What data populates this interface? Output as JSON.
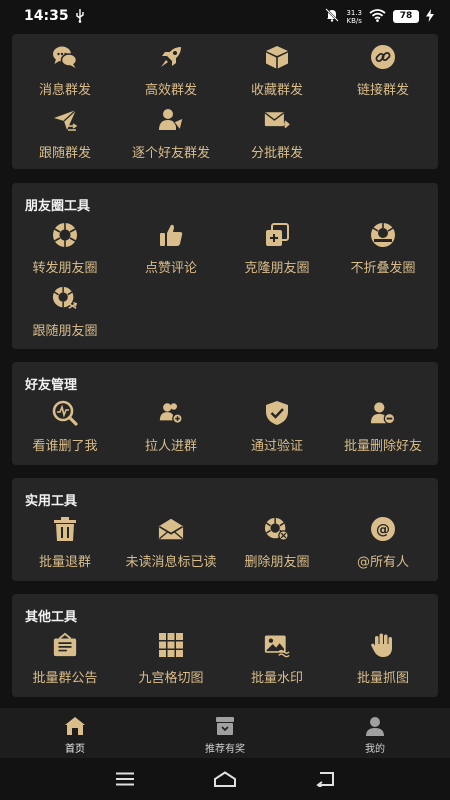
{
  "status_bar": {
    "time": "14:35",
    "usb_icon": "usb-icon",
    "net_speed_value": "31.3",
    "net_speed_unit": "KB/s",
    "battery": "78"
  },
  "colors": {
    "background": "#121212",
    "card": "#262626",
    "accent_gold": "#d9bd8a",
    "title_text": "#f2f2f2"
  },
  "sections": [
    {
      "title": "",
      "items": [
        {
          "label": "消息群发",
          "icon": "chat-bubble-icon"
        },
        {
          "label": "高效群发",
          "icon": "rocket-icon"
        },
        {
          "label": "收藏群发",
          "icon": "box-icon"
        },
        {
          "label": "链接群发",
          "icon": "link-icon"
        },
        {
          "label": "跟随群发",
          "icon": "paper-plane-icon"
        },
        {
          "label": "逐个好友群发",
          "icon": "user-send-icon"
        },
        {
          "label": "分批群发",
          "icon": "mail-forward-icon"
        }
      ]
    },
    {
      "title": "朋友圈工具",
      "items": [
        {
          "label": "转发朋友圈",
          "icon": "shutter-icon"
        },
        {
          "label": "点赞评论",
          "icon": "thumbs-up-icon"
        },
        {
          "label": "克隆朋友圈",
          "icon": "clone-plus-icon"
        },
        {
          "label": "不折叠发圈",
          "icon": "shutter-bar-icon"
        },
        {
          "label": "跟随朋友圈",
          "icon": "shutter-shuffle-icon"
        }
      ]
    },
    {
      "title": "好友管理",
      "items": [
        {
          "label": "看谁删了我",
          "icon": "magnifier-pulse-icon"
        },
        {
          "label": "拉人进群",
          "icon": "users-add-icon"
        },
        {
          "label": "通过验证",
          "icon": "shield-check-icon"
        },
        {
          "label": "批量删除好友",
          "icon": "user-minus-icon"
        }
      ]
    },
    {
      "title": "实用工具",
      "items": [
        {
          "label": "批量退群",
          "icon": "trash-icon"
        },
        {
          "label": "未读消息标已读",
          "icon": "envelope-open-icon"
        },
        {
          "label": "删除朋友圈",
          "icon": "shutter-delete-icon"
        },
        {
          "label": "@所有人",
          "icon": "at-sign-icon"
        }
      ]
    },
    {
      "title": "其他工具",
      "items": [
        {
          "label": "批量群公告",
          "icon": "notice-board-icon"
        },
        {
          "label": "九宫格切图",
          "icon": "grid-nine-icon"
        },
        {
          "label": "批量水印",
          "icon": "image-watermark-icon"
        },
        {
          "label": "批量抓图",
          "icon": "hand-grab-icon"
        }
      ]
    }
  ],
  "tabbar": [
    {
      "label": "首页",
      "icon": "home-icon",
      "active": true
    },
    {
      "label": "推荐有奖",
      "icon": "gift-box-icon",
      "active": false
    },
    {
      "label": "我的",
      "icon": "person-icon",
      "active": false
    }
  ],
  "navbar": {
    "menu_icon": "menu-icon",
    "home_icon": "home-outline-icon",
    "back_icon": "back-icon"
  }
}
